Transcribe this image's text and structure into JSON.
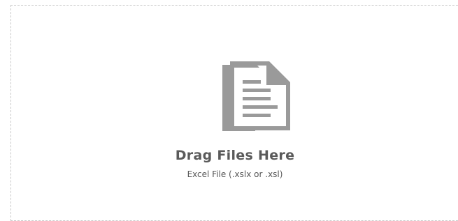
{
  "dropzone": {
    "title": "Drag Files Here",
    "subtitle": "Excel File (.xslx or .xsl)",
    "icon": "documents-icon",
    "icon_color": "#9a9a9a",
    "title_color": "#5a5a5a",
    "border_color": "#c9c9c9"
  }
}
